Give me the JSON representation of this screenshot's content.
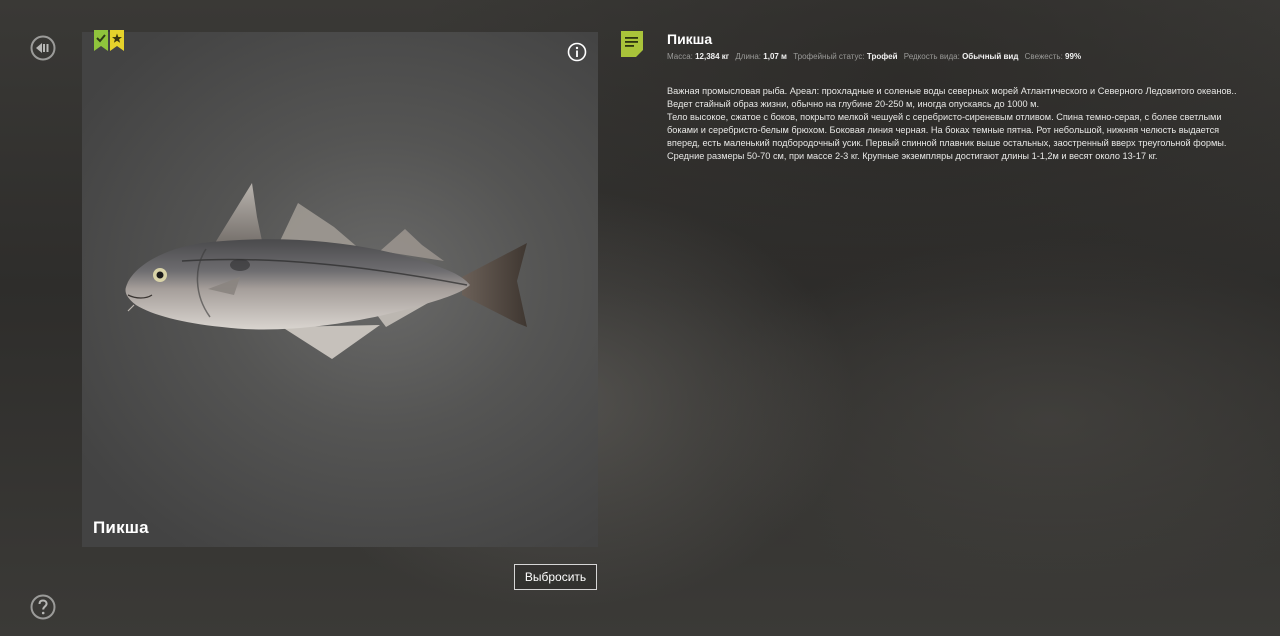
{
  "fish": {
    "name": "Пикша",
    "card_title": "Пикша",
    "stats": {
      "mass_label": "Масса:",
      "mass_value": "12,384 кг",
      "length_label": "Длина:",
      "length_value": "1,07 м",
      "trophy_label": "Трофейный статус:",
      "trophy_value": "Трофей",
      "rarity_label": "Редкость вида:",
      "rarity_value": "Обычный вид",
      "freshness_label": "Свежесть:",
      "freshness_value": "99%"
    },
    "description": [
      "Важная промысловая рыба. Ареал: прохладные и соленые воды северных морей Атлантического и Северного Ледовитого океанов.. Ведет стайный образ жизни, обычно на глубине 20-250 м, иногда опускаясь до 1000 м.",
      "Тело высокое, сжатое с боков, покрыто мелкой чешуей с серебристо-сиреневым отливом. Спина темно-серая, с более светлыми боками и серебристо-белым брюхом. Боковая линия черная. На боках темные пятна. Рот небольшой, нижняя челюсть выдается вперед, есть маленький подбородочный усик. Первый спинной плавник выше остальных, заостренный вверх треугольной формы. Средние размеры 50-70 см, при массе 2-3 кг. Крупные экземпляры достигают длины 1-1,2м и весят около 13-17 кг."
    ]
  },
  "actions": {
    "discard_label": "Выбросить"
  },
  "icons": {
    "back": "back-arrow-icon",
    "help": "help-icon",
    "info": "info-icon",
    "note": "note-icon",
    "badge_check": "check-badge-icon",
    "badge_star": "star-badge-icon"
  },
  "colors": {
    "accent_green": "#8fc43c",
    "accent_yellow": "#e6d22b",
    "text_muted": "#9a9a98"
  }
}
